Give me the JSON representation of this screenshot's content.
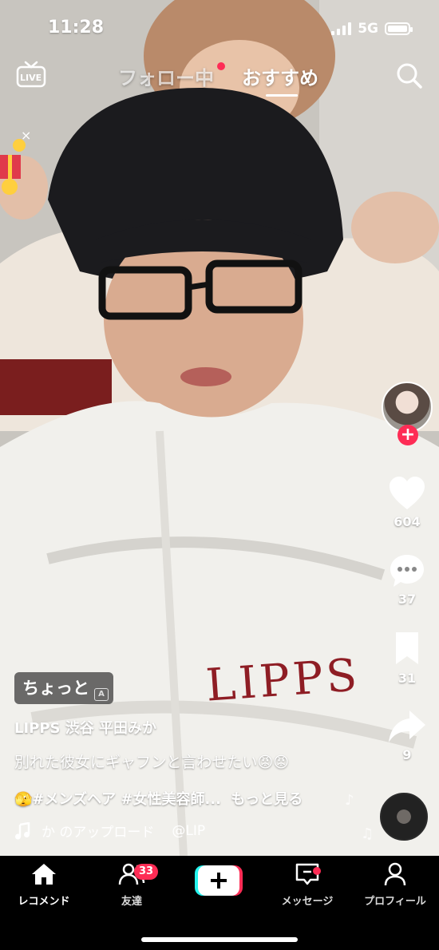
{
  "status_bar": {
    "time": "11:28",
    "network": "5G"
  },
  "top_nav": {
    "live_label": "LIVE",
    "tab_following": "フォロー中",
    "tab_for_you": "おすすめ"
  },
  "gift_widget": {
    "close": "×"
  },
  "right_rail": {
    "likes": "604",
    "comments": "37",
    "bookmarks": "31",
    "shares": "9"
  },
  "caption": {
    "tag_chip": "ちょっと",
    "chip_mark": "A",
    "author": "LIPPS 渋谷 平田みか",
    "description": "別れた彼女にギャフンと言わせたい😡😡",
    "hashtags": "🫣#メンズヘア #女性美容師...",
    "more": "もっと見る",
    "music": "か のアップロード",
    "music_handle": "@LIP"
  },
  "video_print": "LIPPS",
  "bottom_nav": {
    "home": "レコメンド",
    "friends": "友達",
    "friends_badge": "33",
    "messages": "メッセージ",
    "profile": "プロフィール"
  },
  "colors": {
    "accent": "#fe2c55",
    "nav_bg": "#000000"
  }
}
